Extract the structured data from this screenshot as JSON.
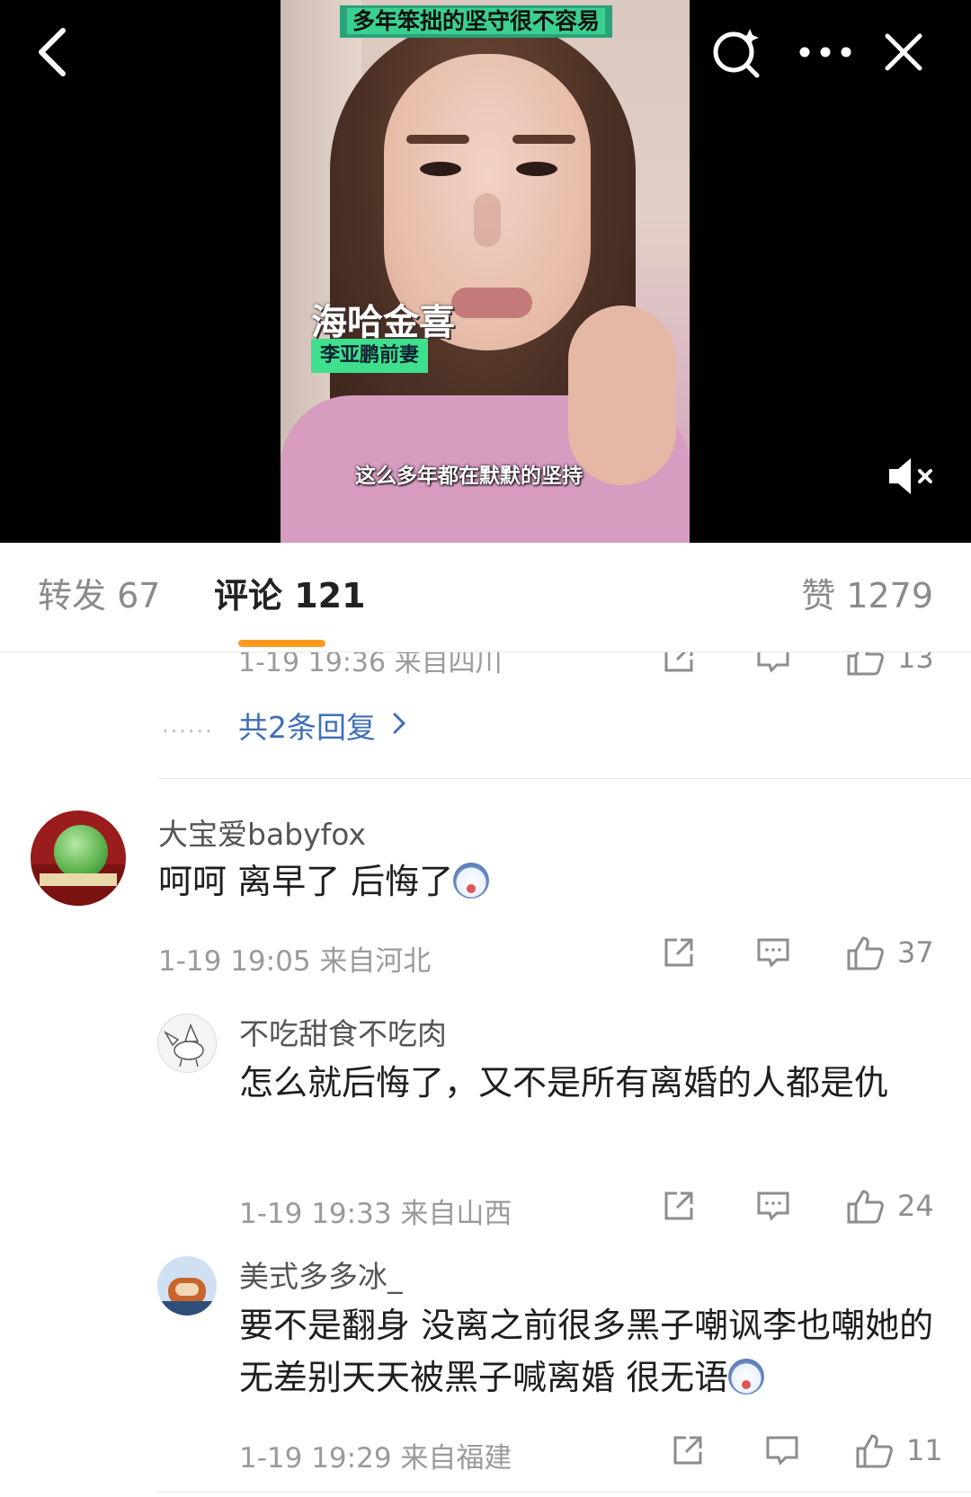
{
  "video": {
    "caption_top": "多年笨拙的坚守很不容易",
    "caption_name": "海哈金喜",
    "caption_sub": "李亚鹏前妻",
    "caption_bottom": "这么多年都在默默的坚持",
    "icons": {
      "back": "back-arrow-icon",
      "search": "search-sparkle-icon",
      "more": "more-dots-icon",
      "close": "close-icon",
      "mute": "muted-speaker-icon"
    }
  },
  "tabs": {
    "repost": "转发 67",
    "comment": "评论 121",
    "like": "赞 1279",
    "active": "comment",
    "indicator_color": "#ff9a1f"
  },
  "partial_comment": {
    "meta": "1-19 19:36 来自四川",
    "likes": "13"
  },
  "more_replies": {
    "label": "共2条回复",
    "dots": "......"
  },
  "comments": [
    {
      "user": "大宝爱babyfox",
      "text": "呵呵 离早了 后悔了",
      "emoji": "husky-emoji",
      "meta": "1-19 19:05 来自河北",
      "likes": "37",
      "replies": [
        {
          "user": "不吃甜食不吃肉",
          "text": "怎么就后悔了，又不是所有离婚的人都是仇",
          "meta": "1-19 19:33 来自山西",
          "likes": "24"
        },
        {
          "user": "美式多多冰_",
          "text": "要不是翻身 没离之前很多黑子嘲讽李也嘲她的  无差别天天被黑子喊离婚 很无语",
          "emoji": "husky-emoji",
          "meta": "1-19 19:29 来自福建",
          "likes": "11"
        }
      ]
    }
  ],
  "colors": {
    "link": "#3f6fb7",
    "meta": "#9a9a9a",
    "accent": "#ff9a1f"
  }
}
